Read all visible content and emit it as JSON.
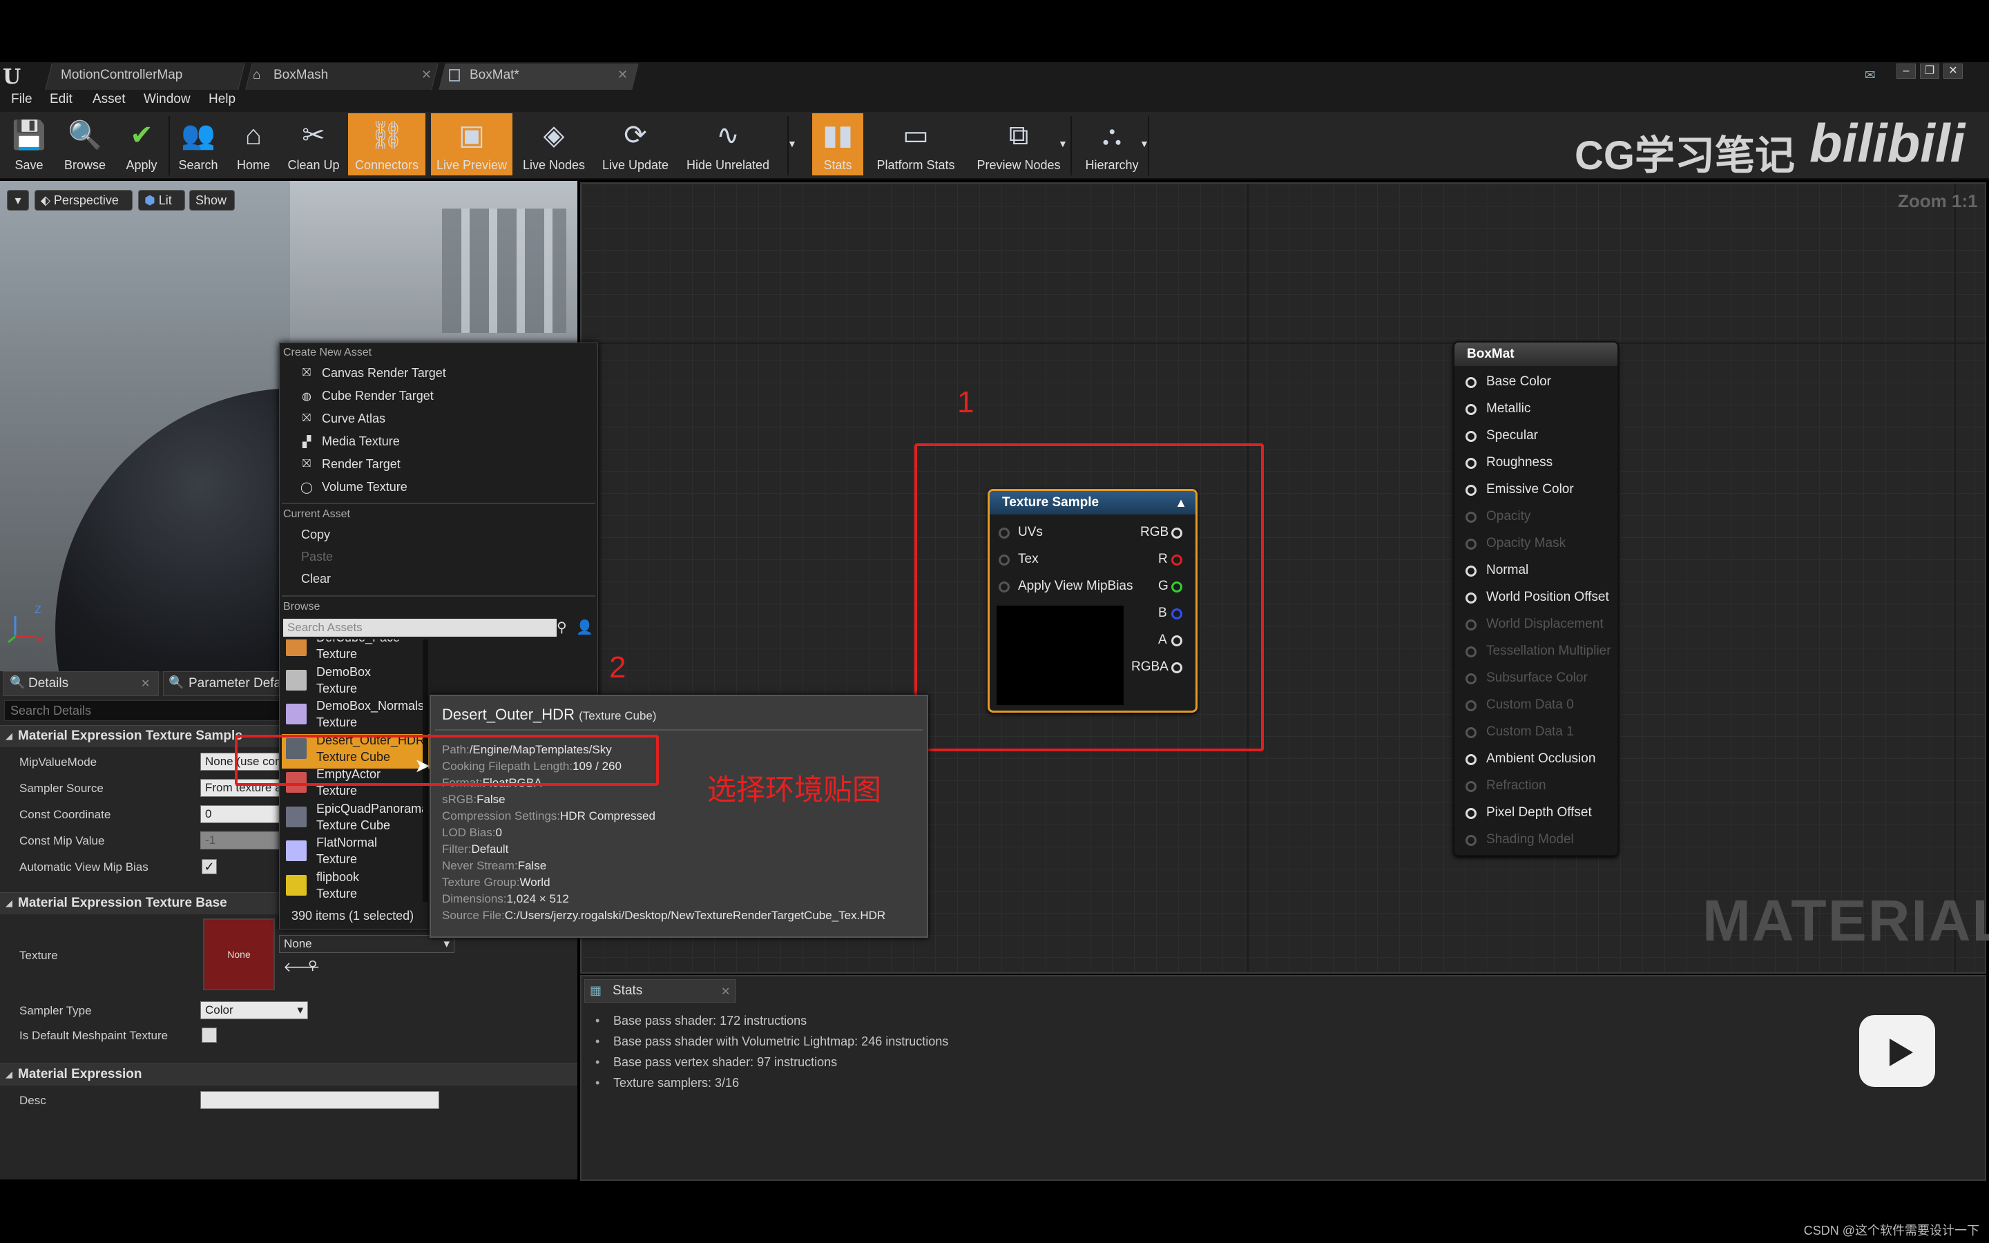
{
  "tabs": [
    {
      "label": "MotionControllerMap"
    },
    {
      "label": "BoxMash"
    },
    {
      "label": "BoxMat*"
    }
  ],
  "menu": [
    "File",
    "Edit",
    "Asset",
    "Window",
    "Help"
  ],
  "toolbar": [
    {
      "label": "Save",
      "icon": "save-icon"
    },
    {
      "label": "Browse",
      "icon": "browse-icon"
    },
    {
      "label": "Apply",
      "icon": "apply-icon"
    },
    {
      "label": "Search",
      "icon": "search-icon"
    },
    {
      "label": "Home",
      "icon": "home-icon"
    },
    {
      "label": "Clean Up",
      "icon": "cleanup-icon"
    },
    {
      "label": "Connectors",
      "icon": "connectors-icon",
      "active": true
    },
    {
      "label": "Live Preview",
      "icon": "live-preview-icon",
      "active": true
    },
    {
      "label": "Live Nodes",
      "icon": "live-nodes-icon"
    },
    {
      "label": "Live Update",
      "icon": "live-update-icon"
    },
    {
      "label": "Hide Unrelated",
      "icon": "hide-unrelated-icon"
    },
    {
      "label": "Stats",
      "icon": "stats-icon",
      "active": true
    },
    {
      "label": "Platform Stats",
      "icon": "platform-stats-icon"
    },
    {
      "label": "Preview Nodes",
      "icon": "preview-nodes-icon"
    },
    {
      "label": "Hierarchy",
      "icon": "hierarchy-icon"
    }
  ],
  "watermark": {
    "text": "CG学习笔记",
    "logo": "bilibili"
  },
  "viewport": {
    "perspective": "Perspective",
    "lit": "Lit",
    "show": "Show",
    "axis_x": "X",
    "axis_z": "Z"
  },
  "details": {
    "tab": "Details",
    "tab2": "Parameter Defaults",
    "search_placeholder": "Search Details",
    "cat1": "Material Expression Texture Sample",
    "props1": [
      {
        "label": "MipValueMode",
        "value": "None (use computed mip level)"
      },
      {
        "label": "Sampler Source",
        "value": "From texture asset"
      },
      {
        "label": "Const Coordinate",
        "value": "0"
      },
      {
        "label": "Const Mip Value",
        "value": "-1"
      },
      {
        "label": "Automatic View Mip Bias",
        "value": "✓"
      }
    ],
    "cat2": "Material Expression Texture Base",
    "texture_label": "Texture",
    "texture_thumb": "None",
    "texture_value": "None",
    "sampler_type_label": "Sampler Type",
    "sampler_type_value": "Color",
    "default_meshpaint_label": "Is Default Meshpaint Texture",
    "cat3": "Material Expression",
    "desc_label": "Desc"
  },
  "context_menu": {
    "h_create": "Create New Asset",
    "create": [
      "Canvas Render Target",
      "Cube Render Target",
      "Curve Atlas",
      "Media Texture",
      "Render Target",
      "Volume Texture"
    ],
    "h_current": "Current Asset",
    "current": [
      "Copy",
      "Paste",
      "Clear"
    ],
    "h_browse": "Browse",
    "search_placeholder": "Search Assets",
    "assets": [
      {
        "name": "DefCube_Face",
        "type": "Texture",
        "color": "#d88a3a"
      },
      {
        "name": "DemoBox",
        "type": "Texture",
        "color": "#bbbbbb"
      },
      {
        "name": "DemoBox_Normals",
        "type": "Texture",
        "color": "#b9a4e6"
      },
      {
        "name": "Desert_Outer_HDR",
        "type": "Texture Cube",
        "color": "#5c6470",
        "selected": true
      },
      {
        "name": "EmptyActor",
        "type": "Texture",
        "color": "#d05050"
      },
      {
        "name": "EpicQuadPanorama",
        "type": "Texture Cube",
        "color": "#6a7080"
      },
      {
        "name": "FlatNormal",
        "type": "Texture",
        "color": "#b8b8ff"
      },
      {
        "name": "flipbook",
        "type": "Texture",
        "color": "#e0c020"
      }
    ],
    "count": "390 items (1 selected)"
  },
  "tooltip": {
    "title": "Desert_Outer_HDR",
    "title_type": "(Texture Cube)",
    "rows": [
      {
        "k": "Path:",
        "v": "/Engine/MapTemplates/Sky"
      },
      {
        "k": "Cooking Filepath Length:",
        "v": "109 / 260"
      },
      {
        "k": "Format:",
        "v": "FloatRGBA"
      },
      {
        "k": "sRGB:",
        "v": "False"
      },
      {
        "k": "Compression Settings:",
        "v": "HDR Compressed"
      },
      {
        "k": "LOD Bias:",
        "v": "0"
      },
      {
        "k": "Filter:",
        "v": "Default"
      },
      {
        "k": "Never Stream:",
        "v": "False"
      },
      {
        "k": "Texture Group:",
        "v": "World"
      },
      {
        "k": "Dimensions:",
        "v": "1,024 × 512"
      },
      {
        "k": "Source File:",
        "v": "C:/Users/jerzy.rogalski/Desktop/NewTextureRenderTargetCube_Tex.HDR"
      }
    ]
  },
  "graph": {
    "zoom": "Zoom 1:1",
    "watermark": "MATERIAL",
    "texture_node": {
      "title": "Texture Sample",
      "inputs": [
        "UVs",
        "Tex",
        "Apply View MipBias"
      ],
      "outputs": [
        "RGB",
        "R",
        "G",
        "B",
        "A",
        "RGBA"
      ]
    },
    "boxmat": {
      "title": "BoxMat",
      "pins": [
        {
          "label": "Base Color",
          "on": true
        },
        {
          "label": "Metallic",
          "on": true
        },
        {
          "label": "Specular",
          "on": true
        },
        {
          "label": "Roughness",
          "on": true
        },
        {
          "label": "Emissive Color",
          "on": true
        },
        {
          "label": "Opacity",
          "on": false
        },
        {
          "label": "Opacity Mask",
          "on": false
        },
        {
          "label": "Normal",
          "on": true
        },
        {
          "label": "World Position Offset",
          "on": true
        },
        {
          "label": "World Displacement",
          "on": false
        },
        {
          "label": "Tessellation Multiplier",
          "on": false
        },
        {
          "label": "Subsurface Color",
          "on": false
        },
        {
          "label": "Custom Data 0",
          "on": false
        },
        {
          "label": "Custom Data 1",
          "on": false
        },
        {
          "label": "Ambient Occlusion",
          "on": true
        },
        {
          "label": "Refraction",
          "on": false
        },
        {
          "label": "Pixel Depth Offset",
          "on": true
        },
        {
          "label": "Shading Model",
          "on": false
        }
      ]
    }
  },
  "annotations": {
    "n1": "1",
    "n2": "2",
    "note": "选择环境贴图"
  },
  "stats": {
    "tab": "Stats",
    "lines": [
      "Base pass shader: 172 instructions",
      "Base pass shader with Volumetric Lightmap: 246 instructions",
      "Base pass vertex shader: 97 instructions",
      "Texture samplers: 3/16"
    ]
  },
  "credit": "CSDN @这个软件需要设计一下"
}
